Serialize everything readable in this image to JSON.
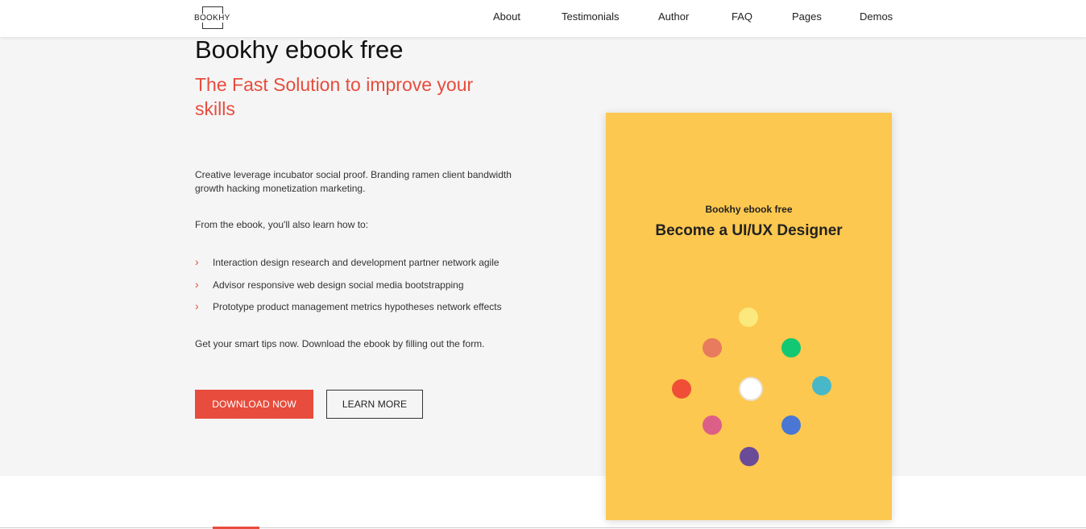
{
  "header": {
    "logo_text": "BOOKHY",
    "nav": [
      "About",
      "Testimonials",
      "Author",
      "FAQ",
      "Pages",
      "Demos"
    ]
  },
  "hero": {
    "title": "Bookhy ebook free",
    "subtitle": "The Fast Solution to improve your skills",
    "intro": "Creative leverage incubator social proof. Branding ramen client bandwidth growth hacking monetization marketing.",
    "learn_intro": "From the ebook, you'll also learn how to:",
    "bullets": [
      "Interaction design research and development partner network agile",
      "Advisor responsive web design social media bootstrapping",
      "Prototype product management metrics hypotheses network effects"
    ],
    "cta_text": "Get your smart tips now. Download the ebook by filling out the form.",
    "primary_button": "DOWNLOAD NOW",
    "secondary_button": "LEARN MORE",
    "bullet_icon": "chevron-right-icon"
  },
  "book": {
    "kicker": "Bookhy ebook free",
    "title": "Become a UI/UX Designer",
    "cover_color": "#fdc84f",
    "dot_colors": {
      "top": "#fbe97e",
      "top_left": "#e87a5e",
      "top_right": "#13c873",
      "left": "#f04e37",
      "right": "#48b8c8",
      "bottom_left": "#dc5f87",
      "bottom_right": "#4a77d3",
      "bottom": "#6a4b98",
      "center": "#ffffff"
    }
  },
  "colors": {
    "accent": "#e74c3c",
    "hero_background": "#f5f5f5"
  }
}
